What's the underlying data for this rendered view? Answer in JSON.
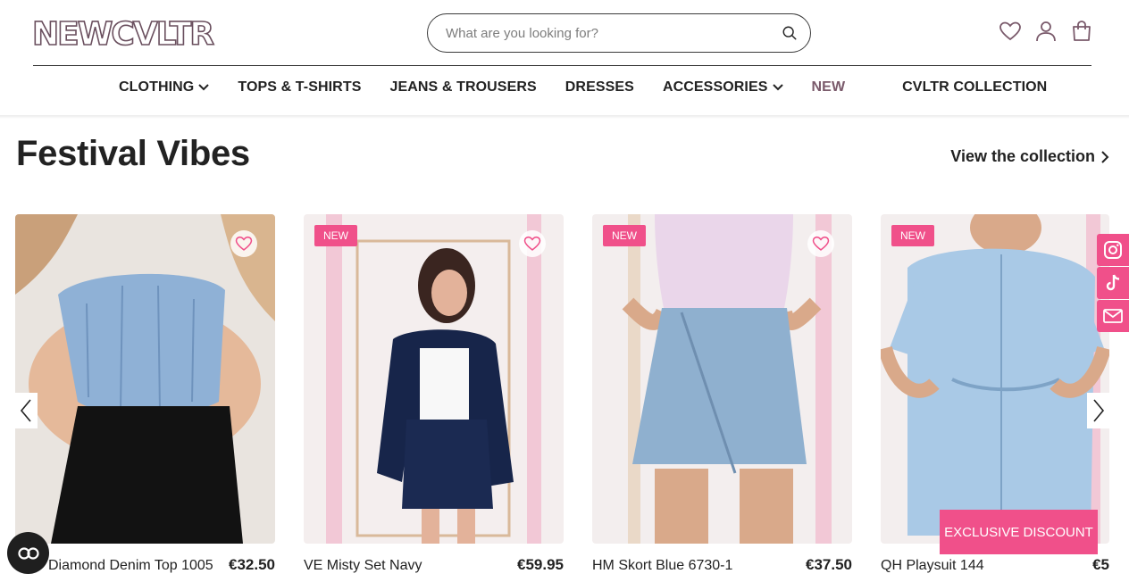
{
  "brand": {
    "logo_text": "NEWCVLTR",
    "accent": "#f0508a"
  },
  "search": {
    "placeholder": "What are you looking for?"
  },
  "header_icons": [
    "heart-icon",
    "user-icon",
    "bag-icon"
  ],
  "nav": {
    "items": [
      {
        "label": "CLOTHING",
        "has_dropdown": true
      },
      {
        "label": "TOPS & T-SHIRTS",
        "has_dropdown": false
      },
      {
        "label": "JEANS & TROUSERS",
        "has_dropdown": false
      },
      {
        "label": "DRESSES",
        "has_dropdown": false
      },
      {
        "label": "ACCESSORIES",
        "has_dropdown": true
      },
      {
        "label": "NEW",
        "has_dropdown": false
      },
      {
        "label": "CVLTR COLLECTION",
        "has_dropdown": false
      }
    ]
  },
  "section": {
    "title": "Festival Vibes",
    "view_link": "View the collection"
  },
  "products": [
    {
      "name": "Diamond Denim Top 1005",
      "price": "€32.50",
      "badge": ""
    },
    {
      "name": "VE Misty Set Navy",
      "price": "€59.95",
      "badge": "NEW"
    },
    {
      "name": "HM Skort Blue 6730-1",
      "price": "€37.50",
      "badge": "NEW"
    },
    {
      "name": "QH Playsuit 144",
      "price": "€5",
      "badge": "NEW"
    }
  ],
  "social": [
    "instagram-icon",
    "tiktok-icon",
    "mail-icon"
  ],
  "discount_button": "EXCLUSIVE DISCOUNT"
}
